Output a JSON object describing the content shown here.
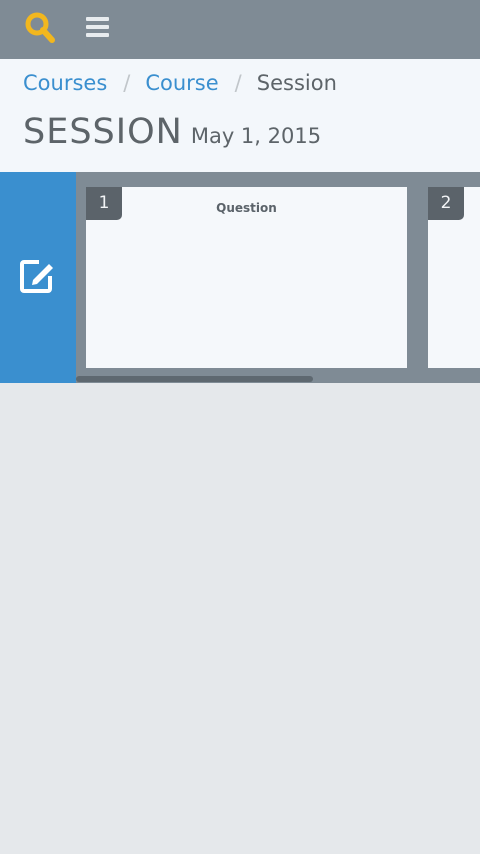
{
  "topbar": {
    "logo_icon": "magnifier-logo-icon",
    "logo_color": "#f2b71e",
    "menu_icon": "hamburger-menu-icon"
  },
  "breadcrumb": {
    "items": [
      {
        "label": "Courses"
      },
      {
        "label": "Course"
      },
      {
        "label": "Session"
      }
    ],
    "separator": "/"
  },
  "page": {
    "title": "SESSION",
    "date": "May 1, 2015"
  },
  "strip": {
    "edit_icon": "edit-icon",
    "accent_color": "#3a8fcf",
    "cards": [
      {
        "number": "1",
        "label": "Question"
      },
      {
        "number": "2",
        "label": ""
      }
    ]
  }
}
